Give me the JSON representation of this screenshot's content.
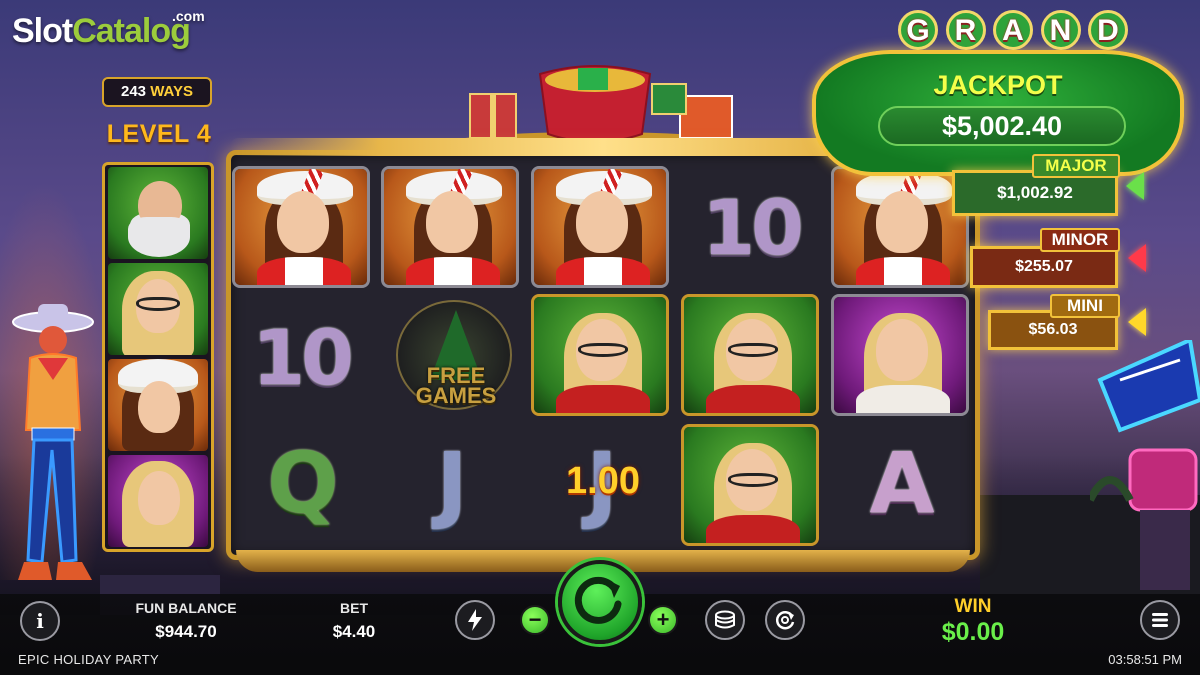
{
  "logo": {
    "part1": "Slot",
    "part2": "Catalog",
    "suffix": ".com"
  },
  "ways": {
    "count": "243",
    "label": "WAYS"
  },
  "level": "LEVEL 4",
  "jackpots": {
    "grand": {
      "letters": [
        "G",
        "R",
        "A",
        "N",
        "D"
      ],
      "title": "JACKPOT",
      "amount": "$5,002.40"
    },
    "major": {
      "label": "MAJOR",
      "amount": "$1,002.92"
    },
    "minor": {
      "label": "MINOR",
      "amount": "$255.07"
    },
    "mini": {
      "label": "MINI",
      "amount": "$56.03"
    }
  },
  "reels": {
    "symbols": [
      [
        "santa-girl",
        "ten",
        "q"
      ],
      [
        "santa-girl",
        "free-games",
        "j"
      ],
      [
        "santa-girl",
        "glasses-girl",
        "j"
      ],
      [
        "ten",
        "glasses-girl",
        "glasses-girl"
      ],
      [
        "santa-girl",
        "blonde-girl",
        "a"
      ]
    ],
    "ten_text": "10",
    "q_text": "Q",
    "j_text": "J",
    "a_text": "A",
    "free_games_text": "FREE GAMES",
    "win_on_reel": "1.00"
  },
  "side_strip": [
    "santa-claus",
    "glasses-girl",
    "santa-girl",
    "blonde-girl"
  ],
  "bottom": {
    "info_label": "i",
    "fun_balance_label": "FUN BALANCE",
    "fun_balance_value": "$944.70",
    "bet_label": "BET",
    "bet_value": "$4.40",
    "minus_label": "−",
    "plus_label": "+",
    "win_label": "WIN",
    "win_value": "$0.00"
  },
  "footer": {
    "game_title": "EPIC HOLIDAY PARTY",
    "time": "03:58:51 PM"
  },
  "colors": {
    "gold": "#c9962a",
    "green_accent": "#3ac23a",
    "win_yellow": "#ffcf2a",
    "win_green": "#6aef4a"
  }
}
